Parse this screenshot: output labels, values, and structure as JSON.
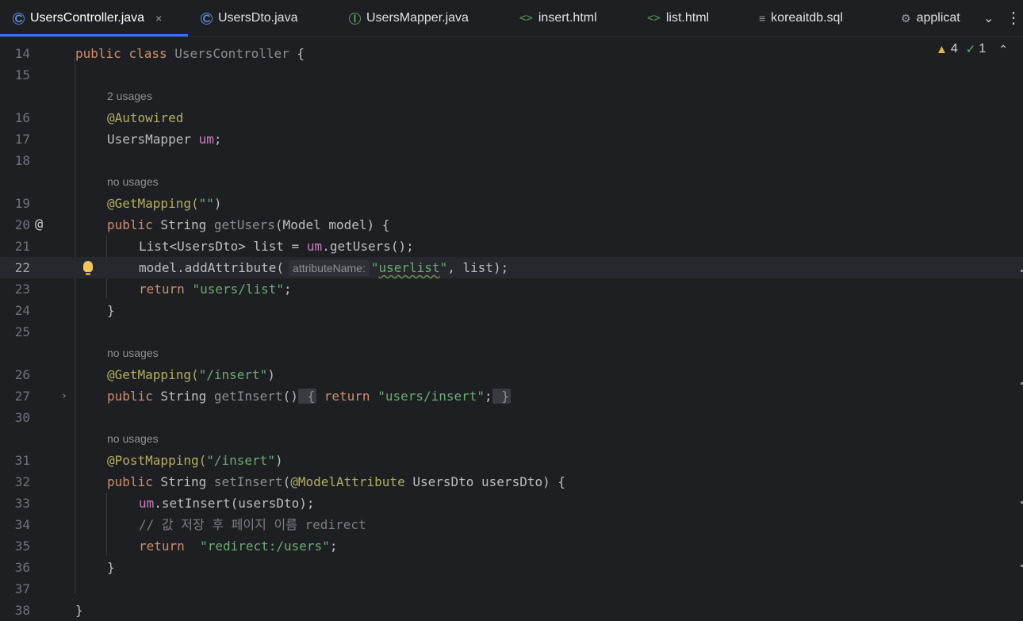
{
  "tabs": [
    {
      "label": "UsersController.java",
      "icon": "class-icon",
      "active": true,
      "close": "×"
    },
    {
      "label": "UsersDto.java",
      "icon": "class-icon",
      "active": false
    },
    {
      "label": "UsersMapper.java",
      "icon": "interface-icon",
      "active": false
    },
    {
      "label": "insert.html",
      "icon": "html-icon",
      "active": false
    },
    {
      "label": "list.html",
      "icon": "html-icon",
      "active": false
    },
    {
      "label": "koreaitdb.sql",
      "icon": "sql-icon",
      "active": false
    },
    {
      "label": "applicat",
      "icon": "settings-icon",
      "active": false
    }
  ],
  "icons": {
    "class": "C",
    "interface": "I",
    "html": "<>",
    "sql": "≡",
    "settings": "⚙",
    "chevron": "⌄",
    "more": "⋮",
    "warning": "▲",
    "ok": "✓",
    "up": "⌃",
    "mention": "@",
    "fold": "›"
  },
  "inspections": {
    "warnings": "4",
    "ok": "1"
  },
  "hints": {
    "usages_2": "2 usages",
    "no_usages": "no usages",
    "param_attributeName": "attributeName:"
  },
  "line_numbers": [
    "14",
    "15",
    "16",
    "17",
    "18",
    "19",
    "20",
    "21",
    "22",
    "23",
    "24",
    "25",
    "26",
    "27",
    "30",
    "31",
    "32",
    "33",
    "34",
    "35",
    "36",
    "37",
    "38"
  ],
  "code": {
    "l14_kw1": "public",
    "l14_kw2": "class",
    "l14_name": "UsersController",
    "l14_rest": " {",
    "l16_ann": "@Autowired",
    "l17_type": "UsersMapper ",
    "l17_field": "um",
    "l17_rest": ";",
    "l19_ann": "@GetMapping(",
    "l19_str": "\"\"",
    "l19_rest": ")",
    "l20_kw": "public",
    "l20_type": " String ",
    "l20_name": "getUsers",
    "l20_rest": "(Model model) {",
    "l21_pre": "List<UsersDto> list = ",
    "l21_field": "um",
    "l21_rest": ".getUsers();",
    "l22_pre": "model.addAttribute(",
    "l22_str_q1": "\"",
    "l22_str_word": "userlist",
    "l22_str_q2": "\"",
    "l22_rest": ", list);",
    "l23_kw": "return",
    "l23_str": "\"users/list\"",
    "l23_rest": ";",
    "l24": "}",
    "l26_ann": "@GetMapping(",
    "l26_str": "\"/insert\"",
    "l26_rest": ")",
    "l27_kw": "public",
    "l27_type": " String ",
    "l27_name": "getInsert",
    "l27_paren": "()",
    "l27_ob": "{",
    "l27_kw2": "return",
    "l27_str": "\"users/insert\"",
    "l27_semi": ";",
    "l27_cb": "}",
    "l31_ann": "@PostMapping(",
    "l31_str": "\"/insert\"",
    "l31_rest": ")",
    "l32_kw": "public",
    "l32_type": " String ",
    "l32_name": "setInsert",
    "l32_p1": "(",
    "l32_ann": "@ModelAttribute",
    "l32_rest": " UsersDto usersDto) {",
    "l33_field": "um",
    "l33_rest": ".setInsert(usersDto);",
    "l34_cmt": "// 값 저장 후 페이지 이름 redirect",
    "l35_kw": "return",
    "l35_str": "\"redirect:/users\"",
    "l35_rest": ";",
    "l36": "}",
    "l38": "}"
  }
}
